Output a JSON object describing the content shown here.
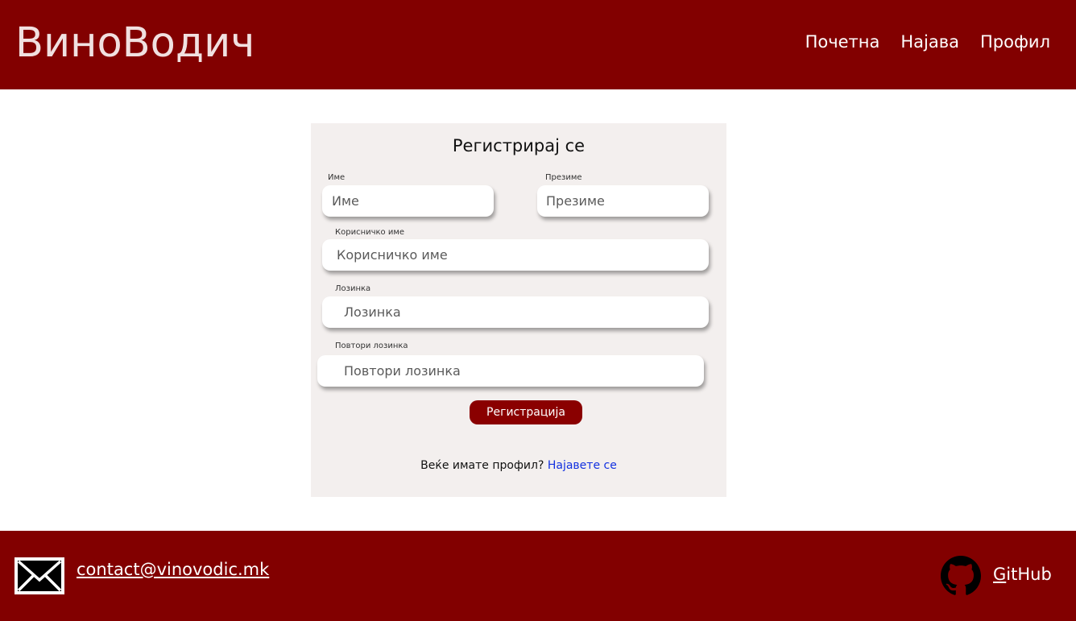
{
  "header": {
    "logo": "ВиноВодич",
    "nav": [
      "Почетна",
      "Најава",
      "Профил"
    ]
  },
  "form": {
    "title": "Регистрирај се",
    "first_name": {
      "label": "Име",
      "placeholder": "Име"
    },
    "last_name": {
      "label": "Презиме",
      "placeholder": "Презиме"
    },
    "username": {
      "label": "Корисничко име",
      "placeholder": "Корисничко име"
    },
    "password": {
      "label": "Лозинка",
      "placeholder": "Лозинка"
    },
    "repeat_password": {
      "label": "Повтори лозинка",
      "placeholder": "Повтори лозинка"
    },
    "submit_label": "Регистрација",
    "have_account_text": "Веќе имате профил?",
    "login_link": "Најавете се"
  },
  "footer": {
    "email": "contact@vinovodic.mk",
    "github_first": "G",
    "github_rest": "itHub"
  },
  "colors": {
    "brand": "#820000",
    "button": "#8a0000",
    "card_bg": "#f3efee",
    "link": "#1230e0"
  },
  "icons": [
    "mail-icon",
    "github-icon"
  ]
}
